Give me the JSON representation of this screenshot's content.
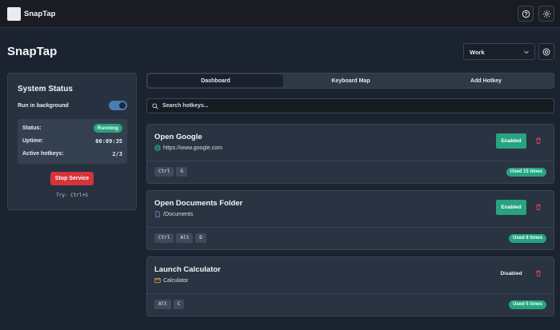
{
  "app": {
    "name": "SnapTap"
  },
  "header": {
    "title": "SnapTap",
    "profile_value": "Work"
  },
  "status": {
    "title": "System Status",
    "run_in_background_label": "Run in background",
    "run_in_background": true,
    "status_label": "Status:",
    "status_value": "Running",
    "uptime_label": "Uptime:",
    "uptime_value": "00:09:35",
    "active_label": "Active hotkeys:",
    "active_value": "2/3",
    "stop_label": "Stop Service",
    "try_text": "Try: Ctrl+G"
  },
  "tabs": [
    {
      "label": "Dashboard",
      "active": true
    },
    {
      "label": "Keyboard Map",
      "active": false
    },
    {
      "label": "Add Hotkey",
      "active": false
    }
  ],
  "search": {
    "placeholder": "Search hotkeys..."
  },
  "hotkeys": [
    {
      "name": "Open Google",
      "target": "https://www.google.com",
      "icon": "globe-icon",
      "keys": [
        "Ctrl",
        "G"
      ],
      "state": "Enabled",
      "used": "Used 15 times"
    },
    {
      "name": "Open Documents Folder",
      "target": "/Documents",
      "icon": "file-icon",
      "keys": [
        "Ctrl",
        "Alt",
        "D"
      ],
      "state": "Enabled",
      "used": "Used 8 times"
    },
    {
      "name": "Launch Calculator",
      "target": "Calculator",
      "icon": "app-window-icon",
      "keys": [
        "Alt",
        "C"
      ],
      "state": "Disabled",
      "used": "Used 5 times"
    }
  ],
  "colors": {
    "accent_green": "#27a380",
    "danger_red": "#d6333a",
    "toggle_blue": "#4b7bb5"
  }
}
